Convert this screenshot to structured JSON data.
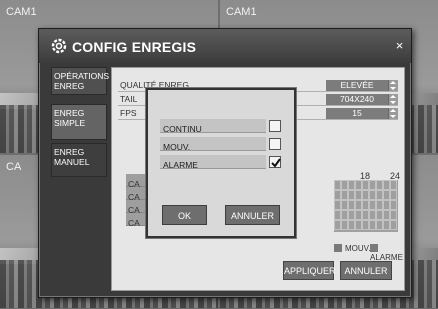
{
  "cameras": [
    "CAM1",
    "CAM1",
    "CA",
    "CA"
  ],
  "dialog": {
    "title": "CONFIG ENREGIS",
    "close_symbol": "×"
  },
  "nav": {
    "operations": "OPÉRATIONS ENREG",
    "simple": "ENREG SIMPLE",
    "manual": "ENREG MANUEL"
  },
  "settings": [
    {
      "label": "QUALITÉ ENREG",
      "value": "ELEVÉE"
    },
    {
      "label": "TAIL",
      "value": "704X240"
    },
    {
      "label": "FPS",
      "value": "15"
    }
  ],
  "schedule": {
    "hours": [
      "18",
      "24"
    ],
    "camera_rows": [
      "CA",
      "CA",
      "CA",
      "CA"
    ],
    "legend": {
      "motion": "MOUV.",
      "alarm": "ALARME"
    }
  },
  "buttons": {
    "apply": "APPLIQUER",
    "cancel": "ANNULER"
  },
  "popup": {
    "options": [
      {
        "label": "CONTINU",
        "checked": false
      },
      {
        "label": "MOUV.",
        "checked": false
      },
      {
        "label": "ALARME",
        "checked": true
      }
    ],
    "ok": "OK",
    "cancel": "ANNULER"
  },
  "icons": {
    "title": "gear-icon",
    "close": "close-icon"
  },
  "colors": {
    "accent": "#3a3a3a",
    "panel": "#e6e6e6"
  }
}
